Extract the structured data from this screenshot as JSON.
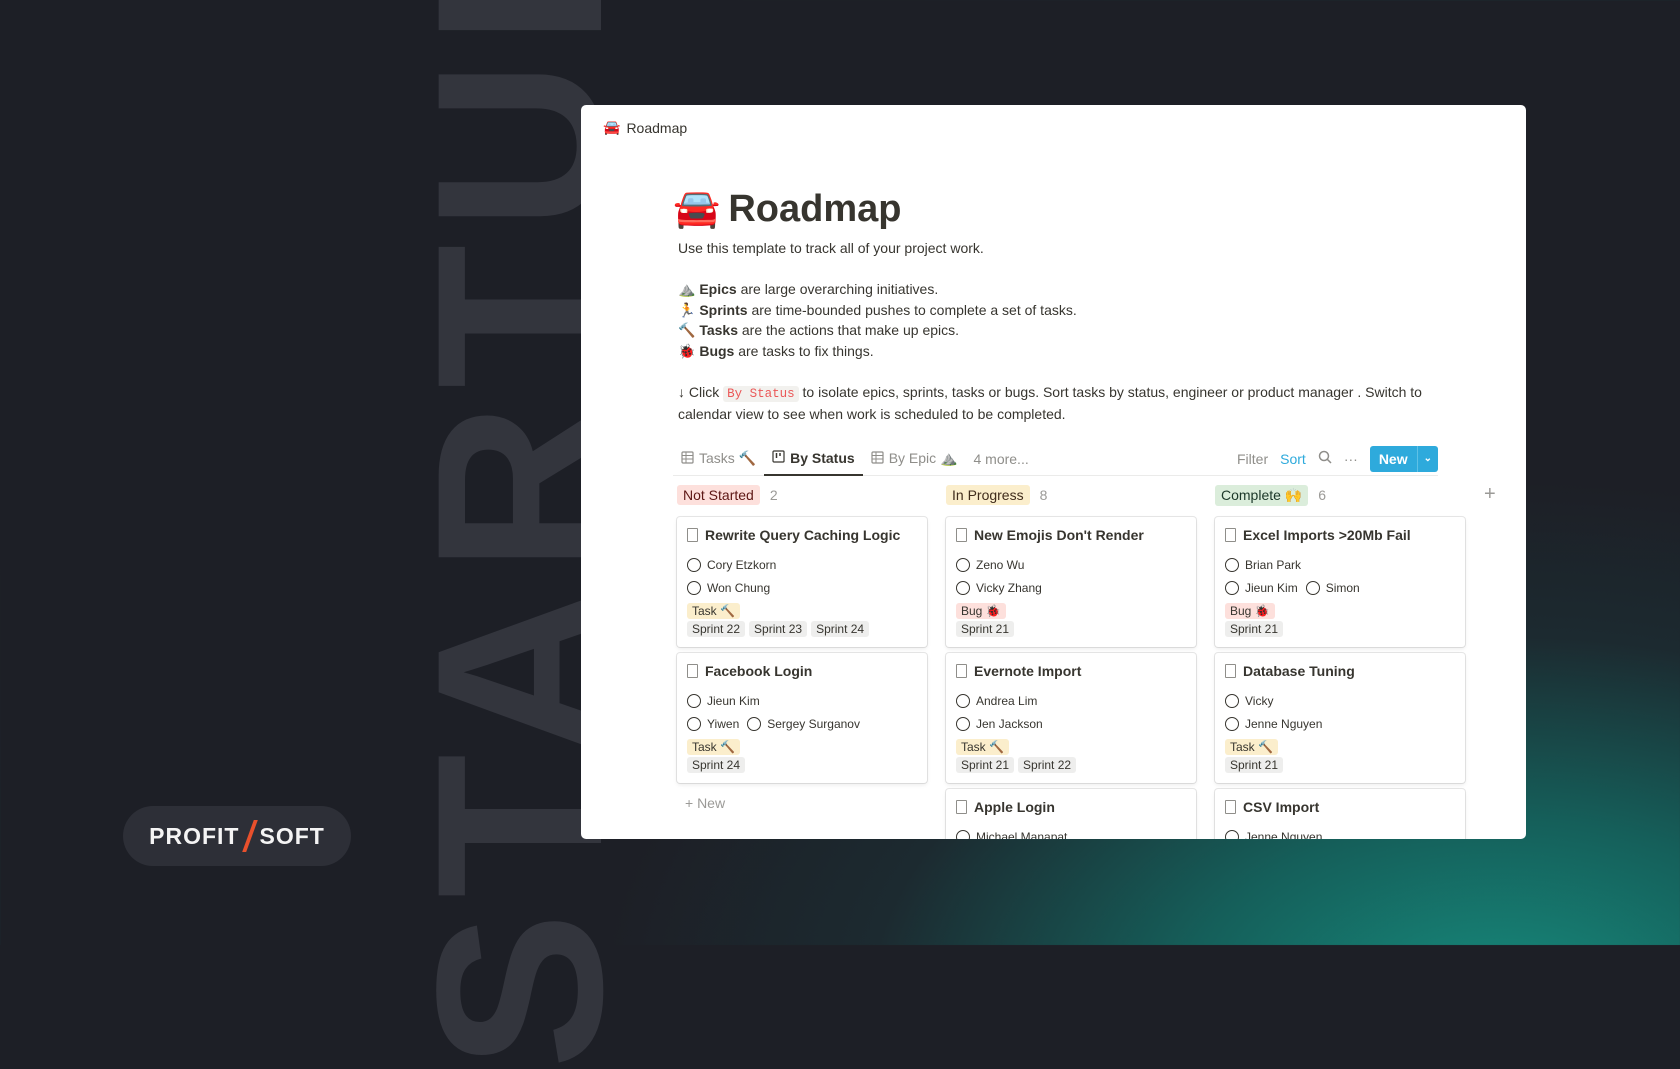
{
  "background": {
    "watermark": "STARTUP",
    "logo": {
      "left": "PROFIT",
      "right": "SOFT",
      "accent": "#e8502c"
    }
  },
  "breadcrumb": {
    "icon": "🚘",
    "label": "Roadmap"
  },
  "page": {
    "icon": "🚘",
    "title": "Roadmap",
    "intro": "Use this template to track all of your project work.",
    "bullets": [
      {
        "icon": "⛰️",
        "term": "Epics",
        "text": " are large overarching initiatives."
      },
      {
        "icon": "🏃",
        "term": "Sprints",
        "text": " are time-bounded pushes to complete a set of tasks."
      },
      {
        "icon": "🔨",
        "term": "Tasks",
        "text": " are the actions that make up epics."
      },
      {
        "icon": "🐞",
        "term": "Bugs",
        "text": " are tasks to fix things."
      }
    ],
    "hint_pre": "↓ Click ",
    "hint_code": "By Status",
    "hint_post": " to isolate epics, sprints, tasks or bugs. Sort tasks by status, engineer or product manager . Switch to calendar view to see when work is scheduled to be completed."
  },
  "tabs": [
    {
      "label": "Tasks 🔨",
      "icon": "table-icon"
    },
    {
      "label": "By Status",
      "icon": "board-icon",
      "active": true
    },
    {
      "label": "By Epic ⛰️",
      "icon": "table-icon"
    },
    {
      "label": "4 more..."
    }
  ],
  "toolbar": {
    "filter": "Filter",
    "sort": "Sort",
    "more": "···",
    "new": "New",
    "dropdown": "⌄"
  },
  "columns": [
    {
      "label": "Not Started",
      "count": "2",
      "color": "#fde0dc",
      "text": "#5d1715",
      "add": "+ New",
      "cards": [
        {
          "title": "Rewrite Query Caching Logic",
          "people": [
            [
              "Cory Etzkorn"
            ],
            [
              "Won Chung"
            ]
          ],
          "tag": "Task 🔨",
          "tagtype": "task",
          "sprints": [
            "Sprint 22",
            "Sprint 23",
            "Sprint 24"
          ]
        },
        {
          "title": "Facebook Login",
          "people": [
            [
              "Jieun Kim"
            ],
            [
              "Yiwen",
              "Sergey Surganov"
            ]
          ],
          "tag": "Task 🔨",
          "tagtype": "task",
          "sprints": [
            "Sprint 24"
          ]
        }
      ]
    },
    {
      "label": "In Progress",
      "count": "8",
      "color": "#fbeecc",
      "text": "#402c1b",
      "cards": [
        {
          "title": "New Emojis Don't Render",
          "people": [
            [
              "Zeno Wu"
            ],
            [
              "Vicky Zhang"
            ]
          ],
          "tag": "Bug 🐞",
          "tagtype": "bug",
          "sprints": [
            "Sprint 21"
          ]
        },
        {
          "title": "Evernote Import",
          "people": [
            [
              "Andrea Lim"
            ],
            [
              "Jen Jackson"
            ]
          ],
          "tag": "Task 🔨",
          "tagtype": "task",
          "sprints": [
            "Sprint 21",
            "Sprint 22"
          ]
        },
        {
          "title": "Apple Login",
          "people": [
            [
              "Michael Manapat"
            ]
          ]
        }
      ]
    },
    {
      "label": "Complete 🙌",
      "count": "6",
      "color": "#dbeddb",
      "text": "#1c3829",
      "cards": [
        {
          "title": "Excel Imports >20Mb Fail",
          "people": [
            [
              "Brian Park"
            ],
            [
              "Jieun Kim",
              "Simon"
            ]
          ],
          "tag": "Bug 🐞",
          "tagtype": "bug",
          "sprints": [
            "Sprint 21"
          ]
        },
        {
          "title": "Database Tuning",
          "people": [
            [
              "Vicky"
            ],
            [
              "Jenne Nguyen"
            ]
          ],
          "tag": "Task 🔨",
          "tagtype": "task",
          "sprints": [
            "Sprint 21"
          ]
        },
        {
          "title": "CSV Import",
          "people": [
            [
              "Jenne Nguyen"
            ]
          ]
        }
      ]
    }
  ],
  "add_group": "+"
}
